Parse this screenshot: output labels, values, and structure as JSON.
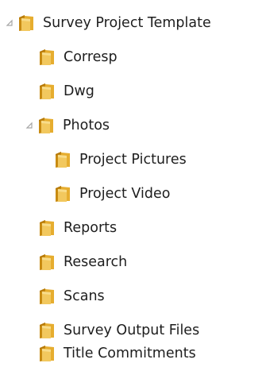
{
  "tree": {
    "root": {
      "label": "Survey Project Template",
      "expanded": true,
      "icon": "folder-icon",
      "children": [
        {
          "label": "Corresp",
          "icon": "folder-icon"
        },
        {
          "label": "Dwg",
          "icon": "folder-icon"
        },
        {
          "label": "Photos",
          "icon": "folder-icon",
          "expanded": true,
          "children": [
            {
              "label": "Project Pictures",
              "icon": "folder-icon"
            },
            {
              "label": "Project Video",
              "icon": "folder-icon"
            }
          ]
        },
        {
          "label": "Reports",
          "icon": "folder-icon"
        },
        {
          "label": "Research",
          "icon": "folder-icon"
        },
        {
          "label": "Scans",
          "icon": "folder-icon"
        },
        {
          "label": "Survey Output Files",
          "icon": "folder-icon"
        },
        {
          "label": "Title Commitments",
          "icon": "folder-icon"
        }
      ]
    }
  },
  "colors": {
    "text": "#1e1e1e",
    "expander": "#a6a6a6",
    "folder_back": "#d49a1a",
    "folder_front": "#f0c354",
    "folder_highlight": "#f8dc8a"
  }
}
